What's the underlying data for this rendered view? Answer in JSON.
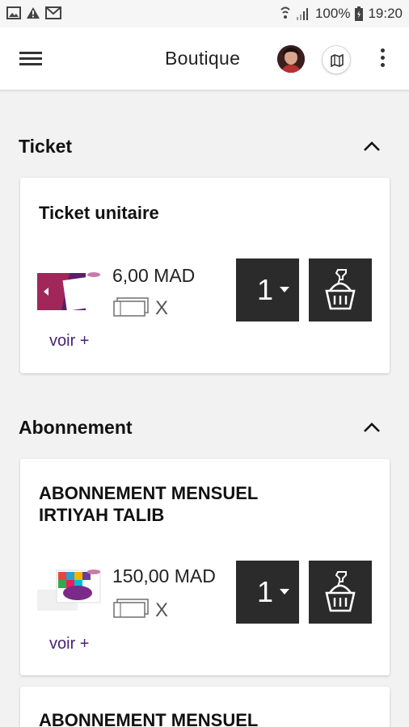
{
  "status_bar": {
    "battery": "100%",
    "time": "19:20",
    "left_icons": [
      "image-icon",
      "warning-icon",
      "mail-icon"
    ],
    "right_icons": [
      "alarm-icon",
      "signal-icon",
      "battery-icon"
    ]
  },
  "appbar": {
    "title": "Boutique",
    "icons": [
      "menu-icon",
      "avatar",
      "map-icon",
      "more-vert-icon"
    ]
  },
  "sections": [
    {
      "title": "Ticket",
      "expanded": true,
      "products": [
        {
          "title": "Ticket unitaire",
          "price": "6,00 MAD",
          "x_label": "X",
          "voir_label": "voir +",
          "quantity": "1"
        }
      ]
    },
    {
      "title": "Abonnement",
      "expanded": true,
      "products": [
        {
          "title_line1": "ABONNEMENT MENSUEL",
          "title_line2": "IRTIYAH TALIB",
          "price": "150,00 MAD",
          "x_label": "X",
          "voir_label": "voir +",
          "quantity": "1"
        },
        {
          "title_line1": "ABONNEMENT MENSUEL"
        }
      ]
    }
  ],
  "colors": {
    "dark_button": "#2b2b2b",
    "link_purple": "#4a2477",
    "background": "#f2f2f2"
  }
}
